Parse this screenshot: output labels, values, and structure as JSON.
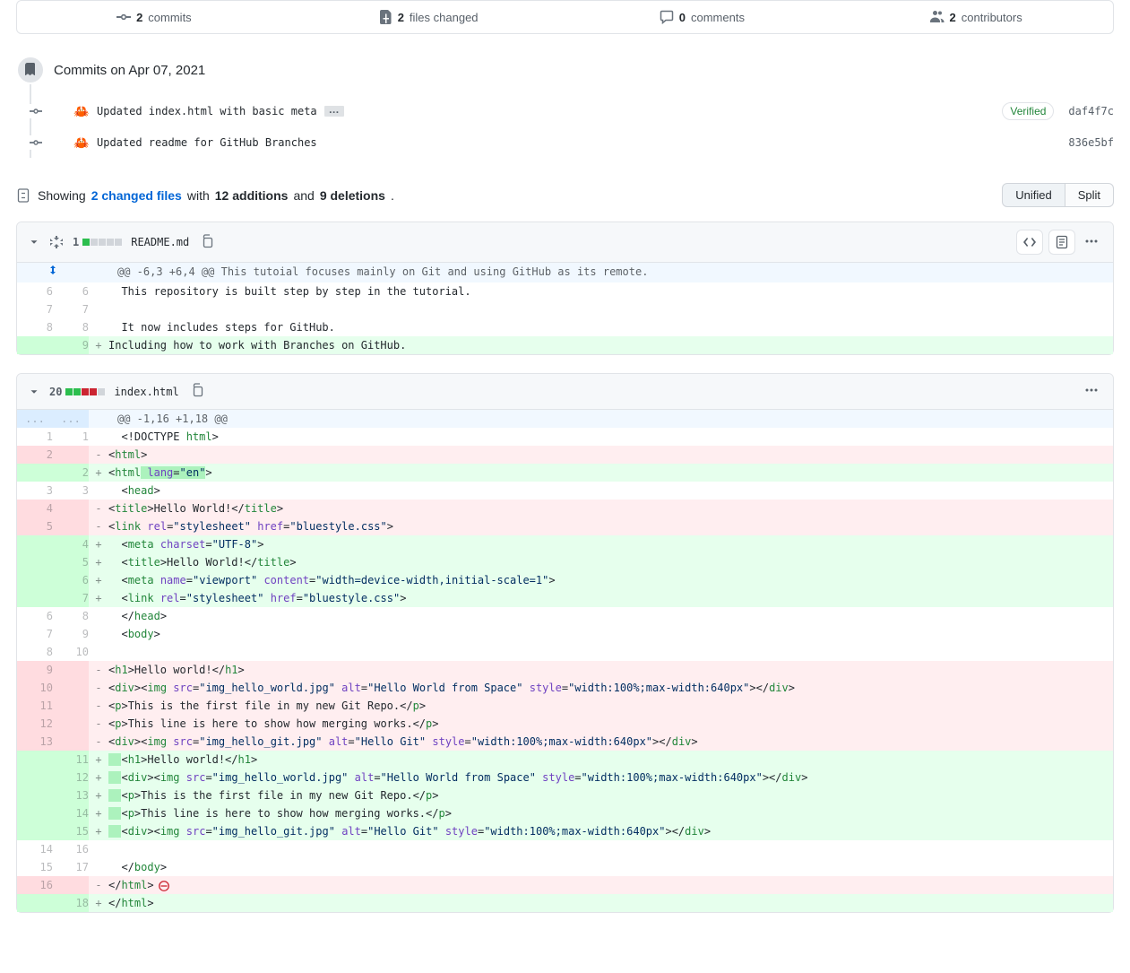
{
  "tabs": {
    "commits": {
      "count": "2",
      "label": "commits"
    },
    "files": {
      "count": "2",
      "label": "files changed"
    },
    "comments": {
      "count": "0",
      "label": "comments"
    },
    "contributors": {
      "count": "2",
      "label": "contributors"
    }
  },
  "timeline": {
    "title": "Commits on Apr 07, 2021",
    "commits": [
      {
        "message": "Updated index.html with basic meta",
        "ellipsis": true,
        "verified": "Verified",
        "sha": "daf4f7c"
      },
      {
        "message": "Updated readme for GitHub Branches",
        "ellipsis": false,
        "verified": "",
        "sha": "836e5bf"
      }
    ]
  },
  "summary": {
    "showing": "Showing",
    "files_link": "2 changed files",
    "with": "with",
    "additions": "12 additions",
    "and": "and",
    "deletions": "9 deletions",
    "period": "."
  },
  "view_toggle": {
    "unified": "Unified",
    "split": "Split"
  },
  "files": [
    {
      "stat": "1",
      "bars": [
        "add",
        "neutral",
        "neutral",
        "neutral",
        "neutral"
      ],
      "name": "README.md",
      "show_toolbar": true
    },
    {
      "stat": "20",
      "bars": [
        "add",
        "add",
        "del",
        "del",
        "neutral"
      ],
      "name": "index.html",
      "show_toolbar": false
    }
  ],
  "readme_hunk": "@@ -6,3 +6,4 @@ This tutoial focuses mainly on Git and using GitHub as its remote.",
  "readme_lines": [
    {
      "type": "ctx",
      "old": "6",
      "new": "6",
      "text": "  This repository is built step by step in the tutorial."
    },
    {
      "type": "ctx",
      "old": "7",
      "new": "7",
      "text": ""
    },
    {
      "type": "ctx",
      "old": "8",
      "new": "8",
      "text": "  It now includes steps for GitHub."
    },
    {
      "type": "add",
      "old": "",
      "new": "9",
      "text": "Including how to work with Branches on GitHub."
    }
  ],
  "index_hunk": "@@ -1,16 +1,18 @@",
  "ellipsis": "..."
}
